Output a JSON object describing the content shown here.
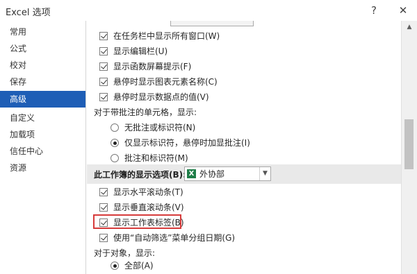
{
  "window": {
    "title": "Excel 选项",
    "help_btn": "?",
    "close_btn": "✕"
  },
  "sidebar": {
    "items": [
      {
        "label": "常用"
      },
      {
        "label": "公式"
      },
      {
        "label": "校对"
      },
      {
        "label": "保存"
      },
      {
        "label": "高级",
        "active": true
      },
      {
        "label": "自定义"
      },
      {
        "label": "加载项"
      },
      {
        "label": "信任中心"
      },
      {
        "label": "资源"
      }
    ]
  },
  "display": {
    "checks": [
      {
        "label": "在任务栏中显示所有窗口(W)",
        "checked": true
      },
      {
        "label": "显示编辑栏(U)",
        "checked": true
      },
      {
        "label": "显示函数屏幕提示(F)",
        "checked": true
      },
      {
        "label": "悬停时显示图表元素名称(C)",
        "checked": true
      },
      {
        "label": "悬停时显示数据点的值(V)",
        "checked": true
      }
    ],
    "comments_label": "对于带批注的单元格，显示:",
    "comment_options": [
      {
        "label": "无批注或标识符(N)",
        "selected": false
      },
      {
        "label": "仅显示标识符，悬停时加显批注(I)",
        "selected": true
      },
      {
        "label": "批注和标识符(M)",
        "selected": false
      }
    ]
  },
  "workbook_section": {
    "title": "此工作簿的显示选项(B):",
    "workbook_name": "外协部",
    "icon": "excel-workbook-icon",
    "checks": [
      {
        "label": "显示水平滚动条(T)",
        "checked": true
      },
      {
        "label": "显示垂直滚动条(V)",
        "checked": true
      },
      {
        "label": "显示工作表标签(B)",
        "checked": true
      },
      {
        "label": "使用“自动筛选”菜单分组日期(G)",
        "checked": true
      }
    ],
    "objects_label": "对于对象，显示:",
    "object_options": [
      {
        "label": "全部(A)",
        "selected": true
      }
    ]
  },
  "colors": {
    "active_bg": "#1e5eb6",
    "highlight_border": "#d63b3b",
    "excel_green": "#1f7d48"
  }
}
